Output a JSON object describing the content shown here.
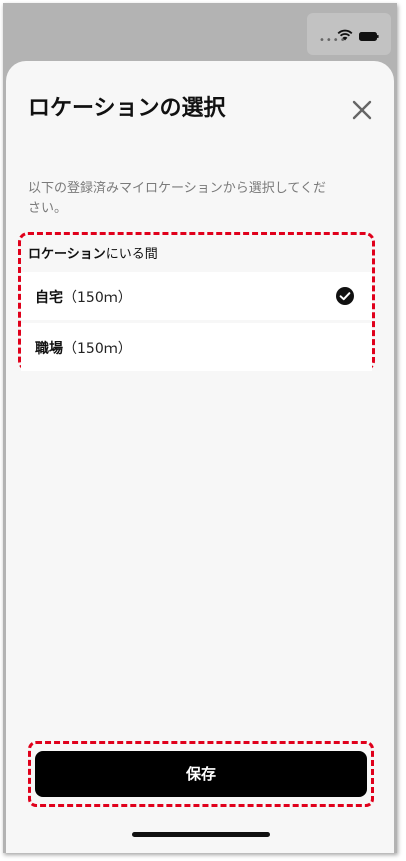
{
  "status_bar": {
    "icons": [
      "signal-dots-icon",
      "wifi-icon",
      "battery-icon"
    ]
  },
  "sheet": {
    "title": "ロケーションの選択",
    "close_icon": "close-icon",
    "description": "以下の登録済みマイロケーションから選択してくだ\nさい。"
  },
  "section": {
    "label_bold": "ロケーション",
    "label_rest": "にいる間",
    "items": [
      {
        "name": "自宅",
        "distance": "（150ｍ）",
        "selected": true
      },
      {
        "name": "職場",
        "distance": "（150ｍ）",
        "selected": false
      }
    ]
  },
  "footer": {
    "save_label": "保存"
  },
  "colors": {
    "highlight": "#e0001b",
    "button_bg": "#000000",
    "sheet_bg": "#f7f7f7",
    "backdrop": "#b3b3b3"
  }
}
